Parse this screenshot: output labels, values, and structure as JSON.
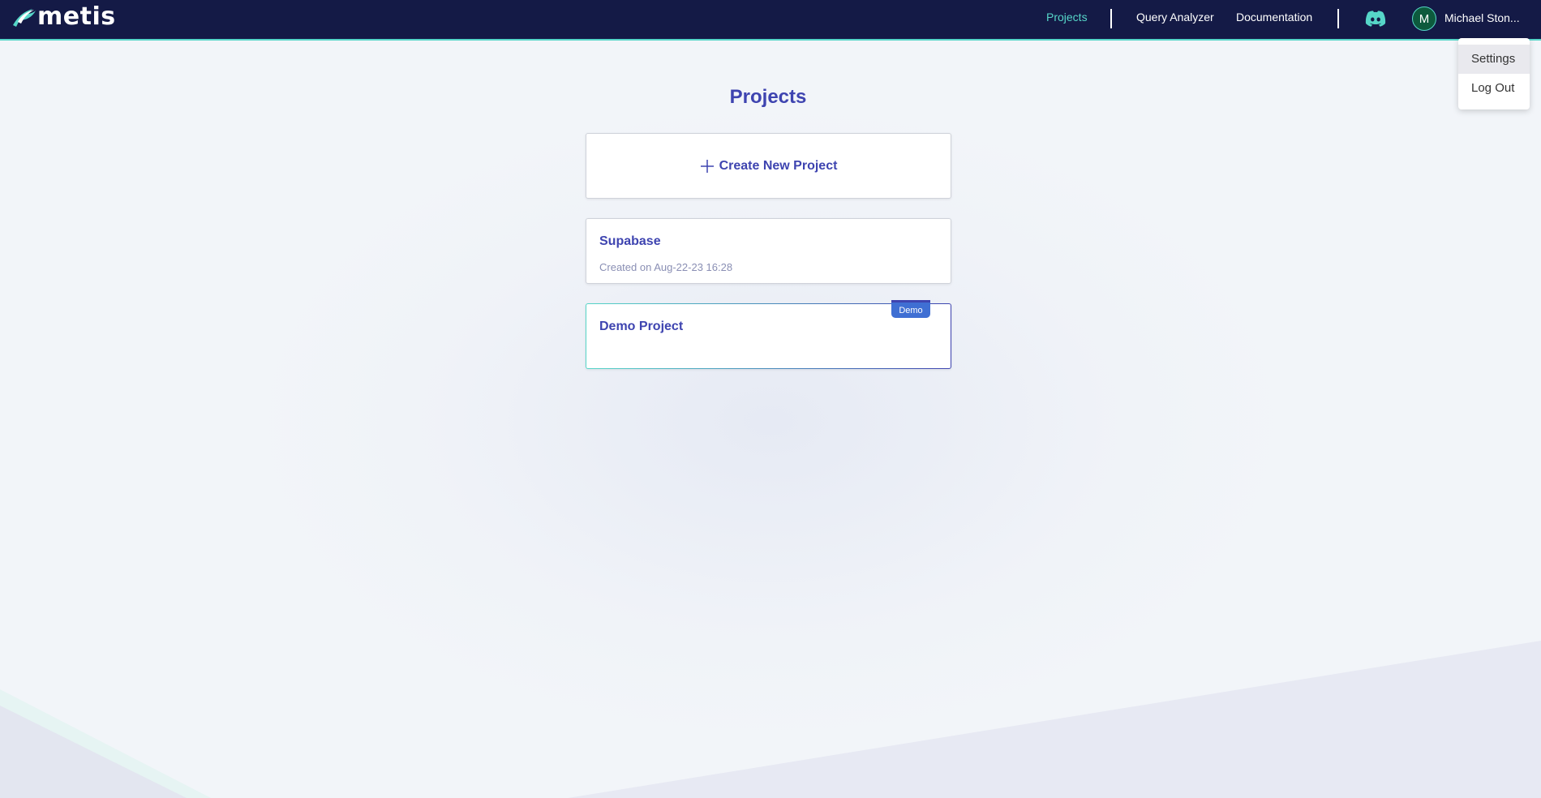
{
  "header": {
    "logo_text": "metis",
    "nav": {
      "projects": "Projects",
      "query_analyzer": "Query Analyzer",
      "documentation": "Documentation"
    },
    "avatar_initial": "M",
    "user_name": "Michael Ston..."
  },
  "dropdown": {
    "items": [
      {
        "label": "Settings"
      },
      {
        "label": "Log Out"
      }
    ]
  },
  "main": {
    "title": "Projects",
    "create_label": "Create New Project",
    "projects": [
      {
        "name": "Supabase",
        "created": "Created on Aug-22-23 16:28"
      },
      {
        "name": "Demo Project",
        "badge": "Demo"
      }
    ]
  },
  "colors": {
    "header_bg": "#141a46",
    "accent_teal": "#56d6c8",
    "brand_blue": "#3e44b0",
    "badge_blue": "#3f6fd3",
    "page_bg": "#f2f5f9"
  },
  "icons": [
    "metis-logo-icon",
    "discord-icon",
    "plus-icon"
  ]
}
